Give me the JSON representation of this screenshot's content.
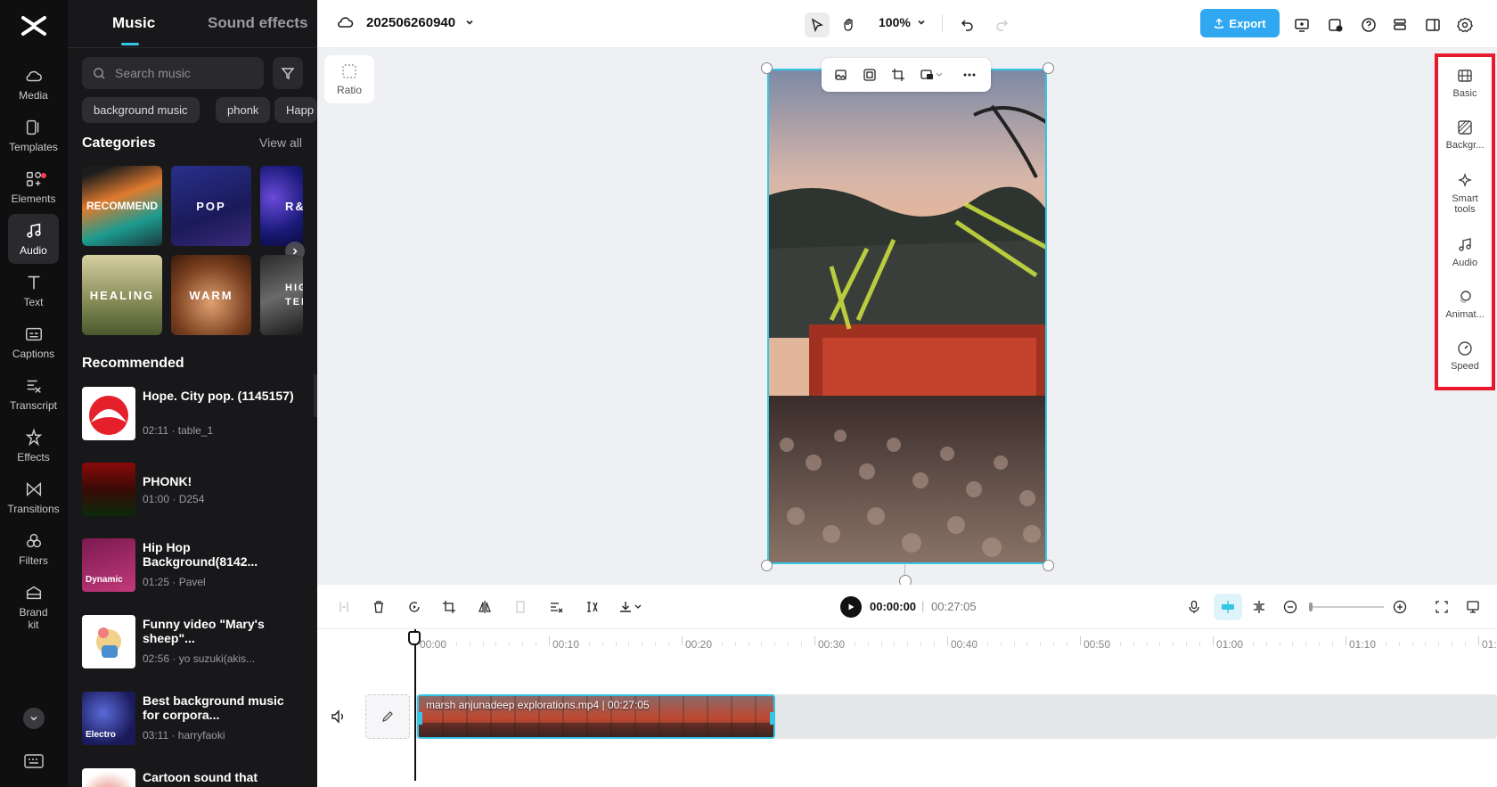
{
  "rail": {
    "items": [
      {
        "label": "Media",
        "icon": "cloud-icon"
      },
      {
        "label": "Templates",
        "icon": "template-icon"
      },
      {
        "label": "Elements",
        "icon": "elements-icon"
      },
      {
        "label": "Audio",
        "icon": "music-note-icon"
      },
      {
        "label": "Text",
        "icon": "text-icon"
      },
      {
        "label": "Captions",
        "icon": "captions-icon"
      },
      {
        "label": "Transcript",
        "icon": "transcript-icon"
      },
      {
        "label": "Effects",
        "icon": "effects-icon"
      },
      {
        "label": "Transitions",
        "icon": "transitions-icon"
      },
      {
        "label": "Filters",
        "icon": "filters-icon"
      },
      {
        "label": "Brand kit",
        "icon": "brand-kit-icon"
      }
    ],
    "active": "Audio"
  },
  "panel": {
    "tabs": [
      "Music",
      "Sound effects"
    ],
    "search_placeholder": "Search music",
    "chips": [
      "background music",
      "phonk",
      "Happ"
    ],
    "categories_title": "Categories",
    "view_all": "View all",
    "categories": [
      "RECOMMEND",
      "POP",
      "R&",
      "HEALING",
      "WARM",
      "HIG TEM"
    ],
    "recommended_title": "Recommended",
    "tracks": [
      {
        "title": "Hope. City pop. (1145157)",
        "meta": "02:11 · table_1",
        "thumb_text": ""
      },
      {
        "title": "PHONK!",
        "meta": "01:00 · D254",
        "thumb_text": ""
      },
      {
        "title": "Hip Hop Background(8142...",
        "meta": "01:25 · Pavel",
        "thumb_text": "Dynamic"
      },
      {
        "title": "Funny video \"Mary's sheep\"...",
        "meta": "02:56 · yo suzuki(akis...",
        "thumb_text": ""
      },
      {
        "title": "Best background music for corpora...",
        "meta": "03:11 · harryfaoki",
        "thumb_text": "Electro"
      },
      {
        "title": "Cartoon sound that",
        "meta": "",
        "thumb_text": ""
      }
    ]
  },
  "topbar": {
    "project_name": "202506260940",
    "zoom": "100%",
    "export_label": "Export"
  },
  "canvas": {
    "ratio_label": "Ratio"
  },
  "props": {
    "items": [
      "Basic",
      "Backgr...",
      "Smart tools",
      "Audio",
      "Animat...",
      "Speed"
    ]
  },
  "timeline": {
    "current_time": "00:00:00",
    "separator": "|",
    "total_time": "00:27:05",
    "ruler": [
      "00:00",
      "00:10",
      "00:20",
      "00:30",
      "00:40",
      "00:50",
      "01:00",
      "01:10",
      "01:"
    ],
    "clip_label": "marsh anjunadeep explorations.mp4",
    "clip_duration": "00:27:05"
  },
  "colors": {
    "accent": "#35c6e6",
    "export": "#2fa8f1",
    "highlight_border": "#e8192c"
  }
}
